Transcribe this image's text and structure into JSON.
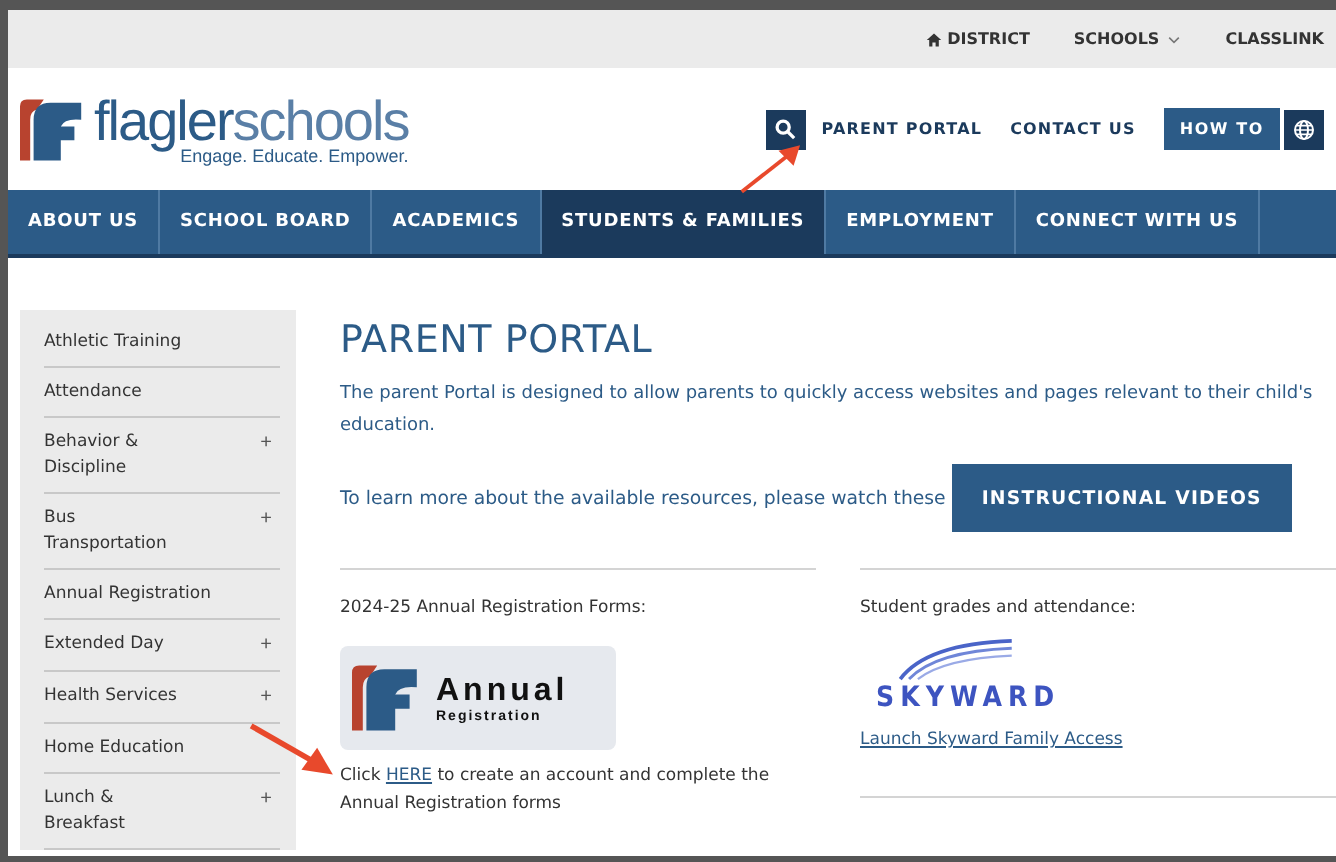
{
  "top_bar": {
    "links": [
      {
        "label": "DISTRICT",
        "kind": "home"
      },
      {
        "label": "SCHOOLS",
        "kind": "dropdown"
      },
      {
        "label": "CLASSLINK",
        "kind": "plain"
      }
    ]
  },
  "header": {
    "logo": {
      "word_a": "flagler",
      "word_b": "schools",
      "tagline": "Engage. Educate. Empower."
    },
    "links": [
      "PARENT PORTAL",
      "CONTACT US"
    ],
    "how_to": "HOW TO"
  },
  "nav": [
    {
      "label": "ABOUT US",
      "selected": false
    },
    {
      "label": "SCHOOL BOARD",
      "selected": false
    },
    {
      "label": "ACADEMICS",
      "selected": false
    },
    {
      "label": "STUDENTS & FAMILIES",
      "selected": true
    },
    {
      "label": "EMPLOYMENT",
      "selected": false
    },
    {
      "label": "CONNECT WITH US",
      "selected": false
    }
  ],
  "sidebar": {
    "items": [
      {
        "label": "Athletic Training"
      },
      {
        "label": "Attendance"
      },
      {
        "label": "Behavior & Discipline",
        "toggle": "+"
      },
      {
        "label": "Bus Transportation",
        "toggle": "+"
      },
      {
        "label": "Annual Registration"
      },
      {
        "label": "Extended Day",
        "toggle": "+"
      },
      {
        "label": "Health Services",
        "toggle": "+"
      },
      {
        "label": "Home Education"
      },
      {
        "label": "Lunch & Breakfast",
        "toggle": "+"
      }
    ]
  },
  "content": {
    "title": "PARENT PORTAL",
    "intro": "The parent Portal is designed to allow parents to quickly access websites and pages relevant to their child's education.",
    "videos_text": "To learn more about the available resources, please watch these",
    "videos_button": "INSTRUCTIONAL VIDEOS",
    "left": {
      "heading": "2024-25 Annual Registration Forms:",
      "badge_title": "Annual",
      "badge_subtitle": "Registration",
      "text_before": "Click",
      "link": "HERE",
      "text_after": "to create an account and complete the Annual Registration forms"
    },
    "right": {
      "heading": "Student grades and attendance:",
      "brand": "SKYWARD",
      "link": "Launch Skyward Family Access"
    }
  }
}
